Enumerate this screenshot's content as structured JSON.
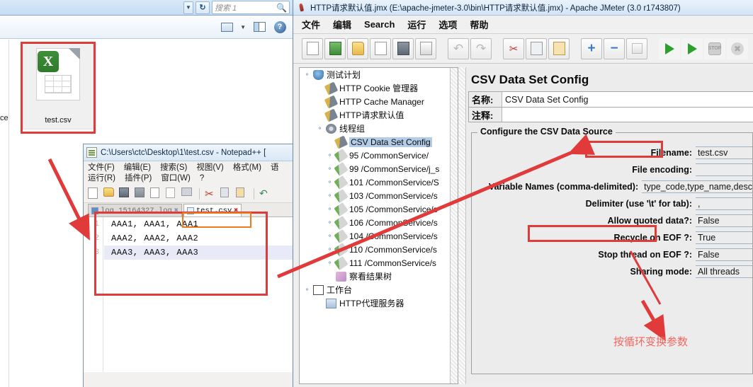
{
  "explorer": {
    "search_placeholder": "搜索 1",
    "refresh_icon": "refresh-icon",
    "caret_icon": "chevron-down-icon",
    "view_icon": "preview-pane-icon",
    "layout_icon": "layout-pane-icon",
    "help_icon": "help-icon",
    "partial_left_text": "ce",
    "file_tile": {
      "name": "test.csv",
      "icon": "excel-csv-file-icon"
    }
  },
  "notepad": {
    "title": "C:\\Users\\ctc\\Desktop\\1\\test.csv - Notepad++ [",
    "icon": "notepadpp-icon",
    "menu_row1": [
      "文件(F)",
      "编辑(E)",
      "搜索(S)",
      "视图(V)",
      "格式(M)",
      "语"
    ],
    "menu_row2": [
      "运行(R)",
      "插件(P)",
      "窗口(W)",
      "?"
    ],
    "toolbar_icons": [
      "new-file-icon",
      "open-file-icon",
      "save-icon",
      "save-all-icon",
      "close-file-icon",
      "close-all-icon",
      "print-icon",
      "cut-icon",
      "copy-icon",
      "paste-icon",
      "undo-icon",
      "redo-icon"
    ],
    "tabs": [
      {
        "label": "log_15164327.log",
        "active": false,
        "close_icon": "close-tab-icon"
      },
      {
        "label": "test.csv",
        "active": true,
        "close_icon": "close-tab-icon"
      }
    ],
    "lines": [
      {
        "no": "1",
        "text": "AAA1, AAA1, AAA1"
      },
      {
        "no": "2",
        "text": "AAA2, AAA2, AAA2"
      },
      {
        "no": "3",
        "text": "AAA3, AAA3, AAA3"
      }
    ]
  },
  "jmeter": {
    "title": "HTTP请求默认值.jmx (E:\\apache-jmeter-3.0\\bin\\HTTP请求默认值.jmx) - Apache JMeter (3.0 r1743807)",
    "app_icon": "jmeter-feather-icon",
    "menu": [
      "文件",
      "编辑",
      "Search",
      "运行",
      "选项",
      "帮助"
    ],
    "toolbar": [
      "new-icon",
      "templates-icon",
      "open-icon",
      "close-icon",
      "save-icon",
      "save-as-icon",
      "undo-icon",
      "redo-icon",
      "cut-icon",
      "copy-icon",
      "paste-icon",
      "expand-all-icon",
      "collapse-all-icon",
      "toggle-icon",
      "start-icon",
      "start-no-timers-icon",
      "stop-icon",
      "shutdown-icon"
    ],
    "tree": [
      {
        "label": "测试计划",
        "indent": 0,
        "icon": "test-plan-icon",
        "handle": "expanded",
        "selected": false
      },
      {
        "label": "HTTP Cookie 管理器",
        "indent": 1,
        "icon": "config-wrench-icon",
        "handle": "",
        "selected": false
      },
      {
        "label": "HTTP Cache Manager",
        "indent": 1,
        "icon": "config-wrench-icon",
        "handle": "",
        "selected": false
      },
      {
        "label": "HTTP请求默认值",
        "indent": 1,
        "icon": "config-wrench-icon",
        "handle": "",
        "selected": false
      },
      {
        "label": "线程组",
        "indent": 1,
        "icon": "thread-group-icon",
        "handle": "expanded",
        "selected": false
      },
      {
        "label": "CSV Data Set Config",
        "indent": 2,
        "icon": "config-wrench-icon",
        "handle": "",
        "selected": true
      },
      {
        "label": "95 /CommonService/",
        "indent": 2,
        "icon": "http-sampler-icon",
        "handle": "collapsed",
        "selected": false
      },
      {
        "label": "99 /CommonService/j_s",
        "indent": 2,
        "icon": "http-sampler-icon",
        "handle": "collapsed",
        "selected": false
      },
      {
        "label": "101 /CommonService/S",
        "indent": 2,
        "icon": "http-sampler-icon",
        "handle": "collapsed",
        "selected": false
      },
      {
        "label": "103 /CommonService/s",
        "indent": 2,
        "icon": "http-sampler-icon",
        "handle": "collapsed",
        "selected": false
      },
      {
        "label": "105 /CommonService/s",
        "indent": 2,
        "icon": "http-sampler-icon",
        "handle": "collapsed",
        "selected": false
      },
      {
        "label": "106 /CommonService/s",
        "indent": 2,
        "icon": "http-sampler-icon",
        "handle": "collapsed",
        "selected": false
      },
      {
        "label": "104 /CommonService/s",
        "indent": 2,
        "icon": "http-sampler-icon",
        "handle": "collapsed",
        "selected": false
      },
      {
        "label": "110 /CommonService/s",
        "indent": 2,
        "icon": "http-sampler-icon",
        "handle": "collapsed",
        "selected": false
      },
      {
        "label": "111 /CommonService/s",
        "indent": 2,
        "icon": "http-sampler-icon",
        "handle": "collapsed",
        "selected": false
      },
      {
        "label": "察看结果树",
        "indent": 2,
        "icon": "view-results-tree-icon",
        "handle": "",
        "selected": false
      },
      {
        "label": "工作台",
        "indent": 0,
        "icon": "workbench-icon",
        "handle": "expanded",
        "selected": false
      },
      {
        "label": "HTTP代理服务器",
        "indent": 1,
        "icon": "http-proxy-icon",
        "handle": "",
        "selected": false
      }
    ],
    "panel": {
      "title": "CSV Data Set Config",
      "name_label": "名称:",
      "name_value": "CSV Data Set Config",
      "comment_label": "注释:",
      "comment_value": "",
      "group_legend": "Configure the CSV Data Source",
      "fields": [
        {
          "label": "Filename:",
          "value": "test.csv"
        },
        {
          "label": "File encoding:",
          "value": ""
        },
        {
          "label": "Variable Names (comma-delimited):",
          "value": "type_code,type_name,desc"
        },
        {
          "label": "Delimiter (use '\\t' for tab):",
          "value": ","
        },
        {
          "label": "Allow quoted data?:",
          "value": "False"
        },
        {
          "label": "Recycle on EOF ?:",
          "value": "True"
        },
        {
          "label": "Stop thread on EOF ?:",
          "value": "False"
        },
        {
          "label": "Sharing mode:",
          "value": "All threads"
        }
      ]
    }
  },
  "annotations": {
    "note_text": "按循环变换参数",
    "note_color": "#f0675f",
    "highlight_color": "#e03a3a",
    "tab_highlight_color": "#f07a1e"
  }
}
